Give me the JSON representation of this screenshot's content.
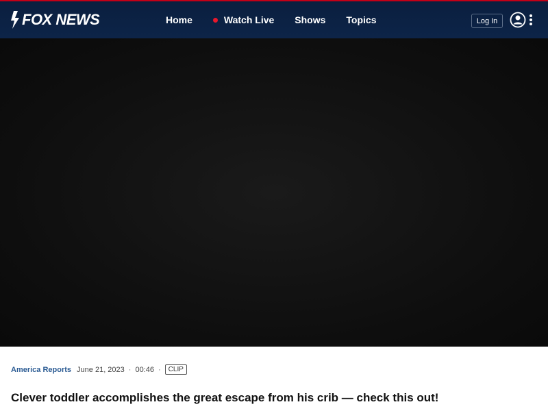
{
  "header": {
    "logo_text": "FOX NEWS",
    "accent_color": "#c20017",
    "nav": [
      {
        "label": "Home"
      },
      {
        "label": "Watch Live",
        "live": true
      },
      {
        "label": "Shows"
      },
      {
        "label": "Topics"
      }
    ],
    "login_label": "Log In",
    "icons": [
      "user-icon",
      "more-vertical-icon"
    ]
  },
  "video": {
    "show": "America Reports",
    "date": "June 21, 2023",
    "duration": "00:46",
    "badge": "CLIP",
    "title": "Clever toddler accomplishes the great escape from his crib — check this out!"
  }
}
